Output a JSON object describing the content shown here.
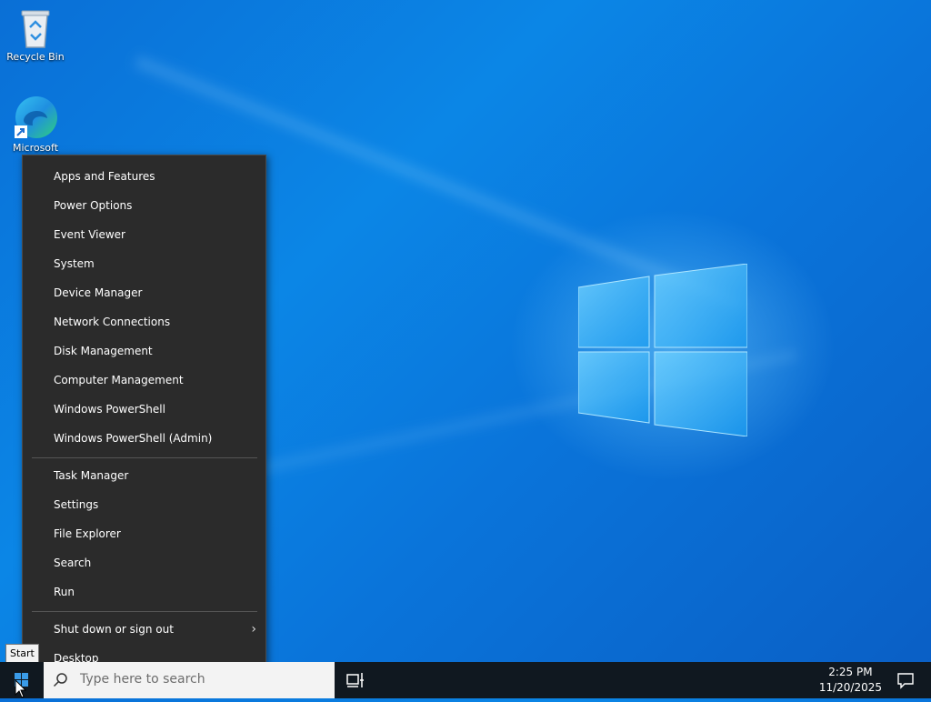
{
  "desktop": {
    "icons": [
      {
        "label": "Recycle Bin",
        "icon": "recycle-bin-icon"
      },
      {
        "label": "Microsoft",
        "icon": "edge-icon"
      }
    ]
  },
  "context_menu": {
    "groups": [
      [
        "Apps and Features",
        "Power Options",
        "Event Viewer",
        "System",
        "Device Manager",
        "Network Connections",
        "Disk Management",
        "Computer Management",
        "Windows PowerShell",
        "Windows PowerShell (Admin)"
      ],
      [
        "Task Manager",
        "Settings",
        "File Explorer",
        "Search",
        "Run"
      ],
      [
        "Shut down or sign out",
        "Desktop"
      ]
    ],
    "submenu_indicator": "›"
  },
  "tooltip": {
    "text": "Start"
  },
  "taskbar": {
    "search_placeholder": "Type here to search",
    "time": "2:25 PM",
    "date": "11/20/2025"
  },
  "colors": {
    "menu_bg": "#2b2b2b",
    "taskbar_bg": "#101820",
    "wallpaper_accent": "#0a78dc"
  }
}
